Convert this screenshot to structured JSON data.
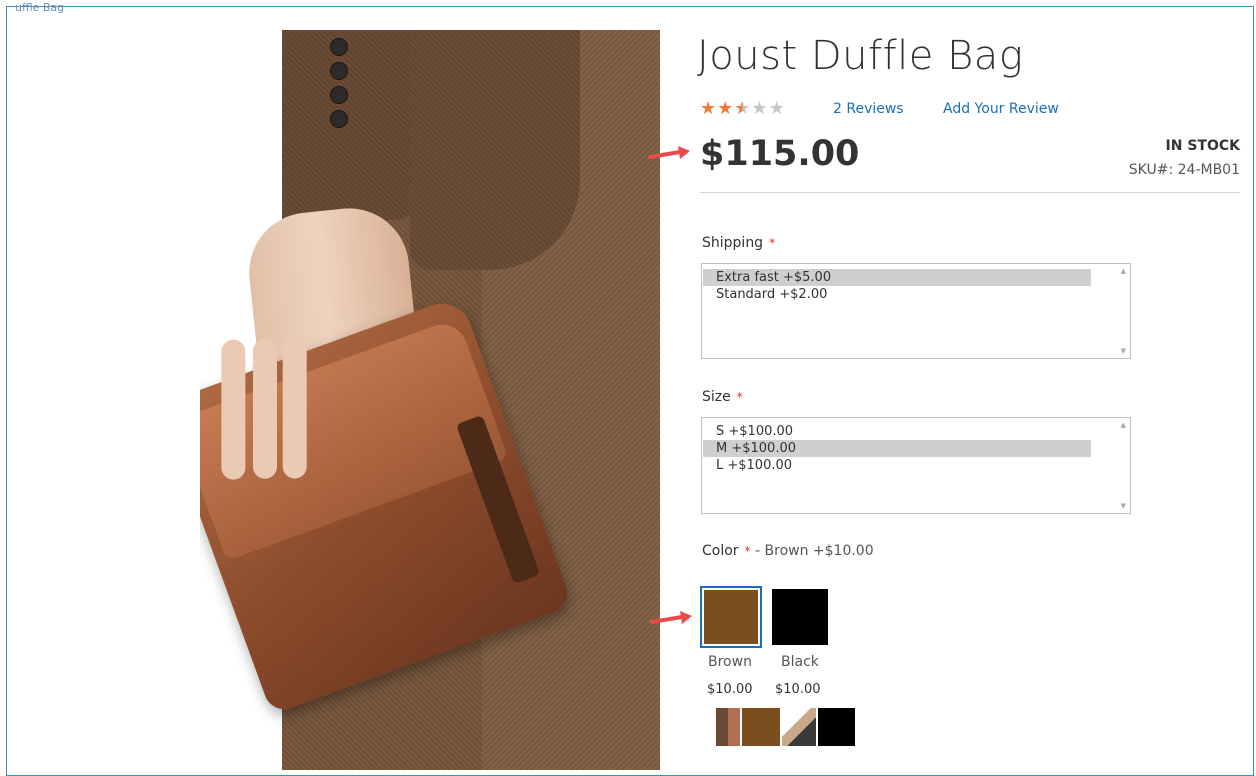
{
  "breadcrumb": "uffle Bag",
  "product": {
    "title": "Joust Duffle Bag",
    "rating": {
      "filled": 2.5,
      "max": 5
    },
    "reviews_link": "2  Reviews",
    "add_review_link": "Add Your Review",
    "price": "$115.00",
    "stock": "IN STOCK",
    "sku": "SKU#:  24-MB01"
  },
  "options": {
    "shipping": {
      "label": "Shipping",
      "required": "*",
      "items": [
        "Extra fast +$5.00",
        "Standard +$2.00"
      ],
      "selected": 0
    },
    "size": {
      "label": "Size",
      "required": "*",
      "items": [
        "S +$100.00",
        "M +$100.00",
        "L +$100.00"
      ],
      "selected": 1
    },
    "color": {
      "label": "Color",
      "required": "*",
      "selected_text": "- Brown +$10.00",
      "swatches": [
        {
          "name": "Brown",
          "price": "$10.00",
          "color": "#7a4e1e"
        },
        {
          "name": "Black",
          "price": "$10.00",
          "color": "#000000"
        }
      ]
    }
  },
  "colors": {
    "link": "#1a6fb8",
    "star": "#ee7a35",
    "required": "#e02b27",
    "arrow": "#e94b4b",
    "border": "#3a8fc8"
  }
}
